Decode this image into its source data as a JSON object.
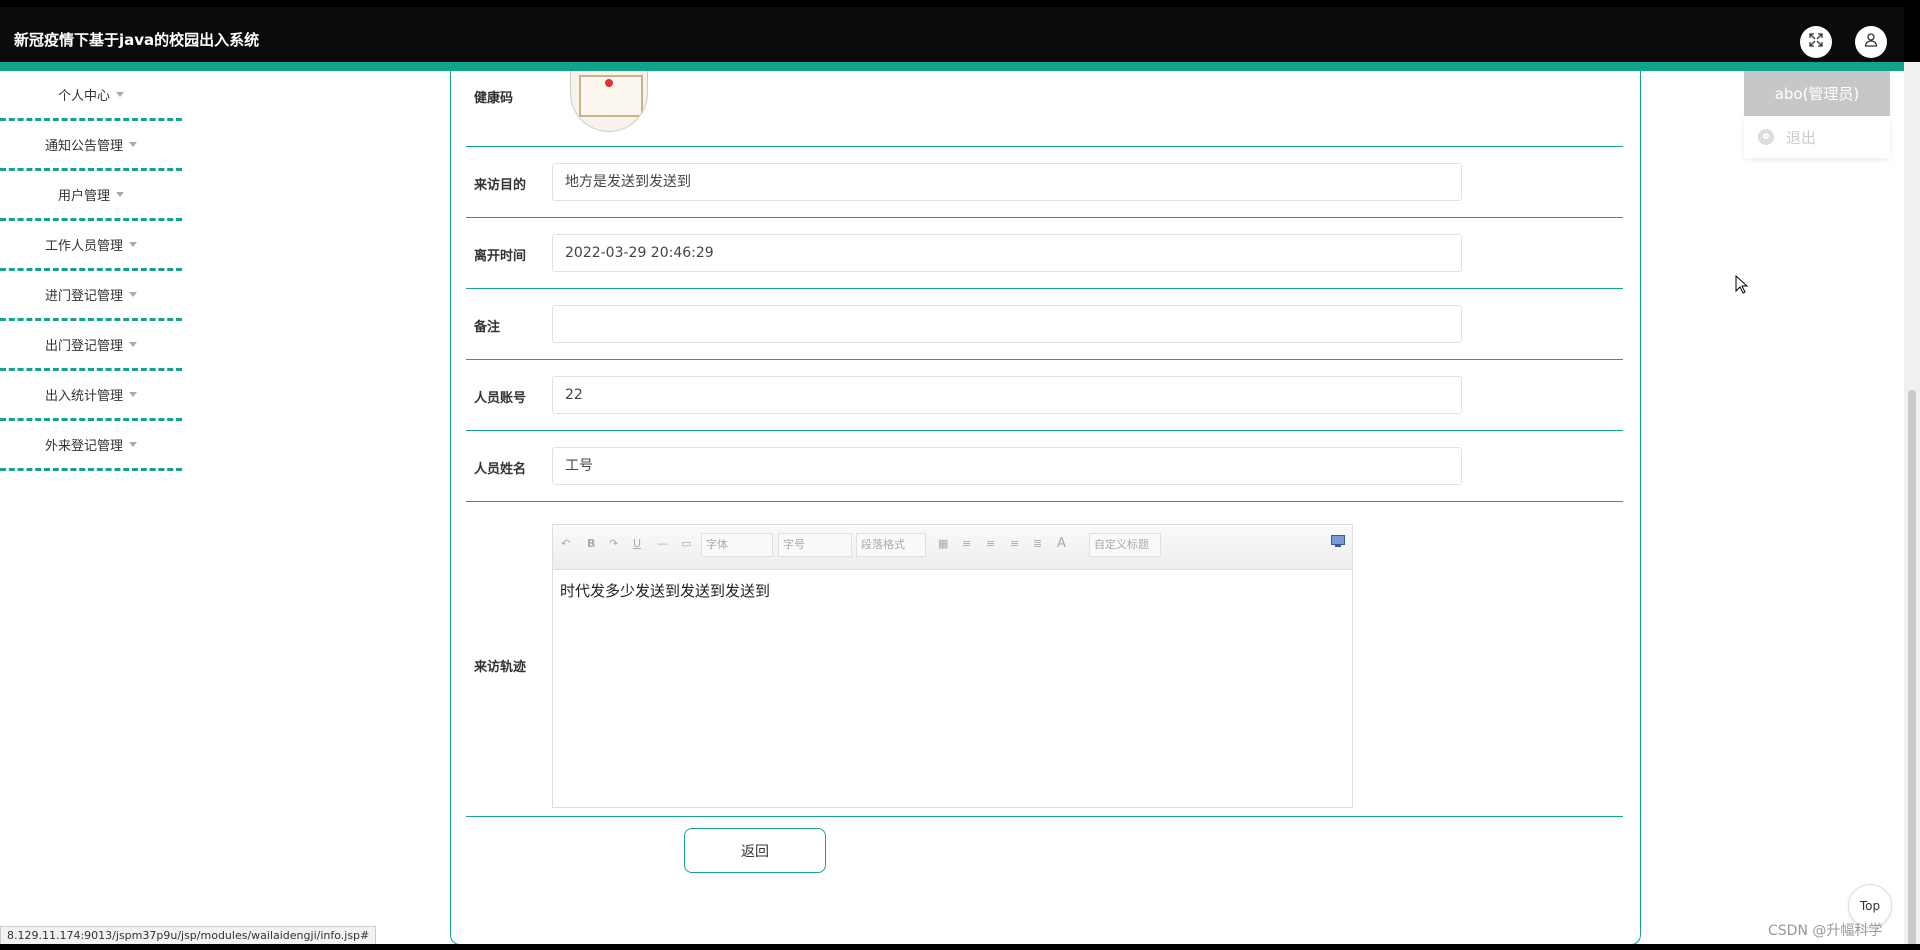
{
  "app": {
    "title": "新冠疫情下基于java的校园出入系统"
  },
  "header": {
    "fullscreen_icon": "expand-icon",
    "user_icon": "user-icon"
  },
  "sidebar": {
    "items": [
      {
        "label": "个人中心"
      },
      {
        "label": "通知公告管理"
      },
      {
        "label": "用户管理"
      },
      {
        "label": "工作人员管理"
      },
      {
        "label": "进门登记管理"
      },
      {
        "label": "出门登记管理"
      },
      {
        "label": "出入统计管理"
      },
      {
        "label": "外来登记管理"
      }
    ]
  },
  "form": {
    "health_code": {
      "label": "健康码"
    },
    "purpose": {
      "label": "来访目的",
      "value": "地方是发送到发送到"
    },
    "leave_time": {
      "label": "离开时间",
      "value": "2022-03-29 20:46:29"
    },
    "remark": {
      "label": "备注",
      "value": ""
    },
    "account": {
      "label": "人员账号",
      "value": "22"
    },
    "name": {
      "label": "人员姓名",
      "value": "工号"
    },
    "track": {
      "label": "来访轨迹",
      "content": "时代发多少发送到发送到发送到",
      "toolbar": {
        "font": "字体",
        "size": "字号",
        "paragraph": "段落格式",
        "custom_title": "自定义标题",
        "bold": "B",
        "underline": "U",
        "color": "A"
      }
    },
    "back_button": "返回"
  },
  "user_menu": {
    "user": "abo(管理员)",
    "logout": "退出"
  },
  "top_button": "Top",
  "status_url": "8.129.11.174:9013/jspm37p9u/jsp/modules/wailaidengji/info.jsp#",
  "watermark": "CSDN @升幅科学",
  "colors": {
    "accent": "#13a38a",
    "header_bg": "#0b0b0b"
  }
}
